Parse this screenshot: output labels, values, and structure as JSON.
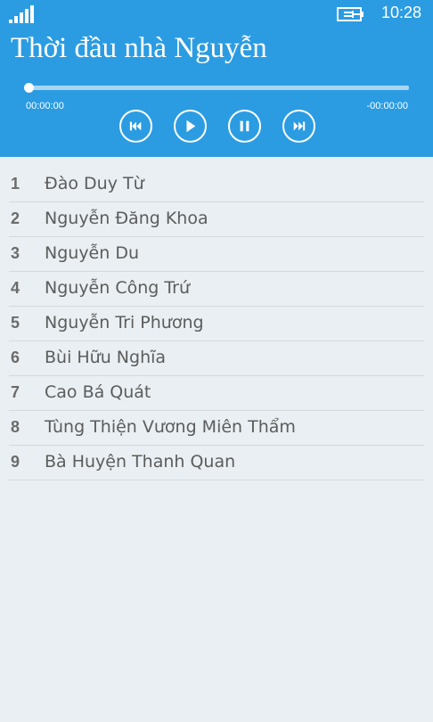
{
  "status_bar": {
    "time": "10:28",
    "signal_icon": "signal-icon",
    "battery_icon": "battery-charging-icon"
  },
  "app": {
    "title": "Thời đầu nhà Nguyễn"
  },
  "player": {
    "elapsed": "00:00:00",
    "remaining": "-00:00:00",
    "progress": 0,
    "controls": [
      {
        "name": "previous",
        "icon": "skip-previous-icon"
      },
      {
        "name": "play",
        "icon": "play-icon"
      },
      {
        "name": "pause",
        "icon": "pause-icon"
      },
      {
        "name": "next",
        "icon": "skip-next-icon"
      }
    ]
  },
  "tracks": [
    {
      "number": "1",
      "title": "Đào Duy Từ"
    },
    {
      "number": "2",
      "title": "Nguyễn Đăng Khoa"
    },
    {
      "number": "3",
      "title": "Nguyễn Du"
    },
    {
      "number": "4",
      "title": "Nguyễn Công Trứ"
    },
    {
      "number": "5",
      "title": "Nguyễn Tri Phương"
    },
    {
      "number": "6",
      "title": "Bùi Hữu Nghĩa"
    },
    {
      "number": "7",
      "title": "Cao Bá Quát"
    },
    {
      "number": "8",
      "title": "Tùng Thiện Vương Miên Thẩm"
    },
    {
      "number": "9",
      "title": "Bà Huyện Thanh Quan"
    }
  ],
  "colors": {
    "accent": "#2b9ce2",
    "background": "#e9eff2",
    "text": "#5c5c5c"
  }
}
